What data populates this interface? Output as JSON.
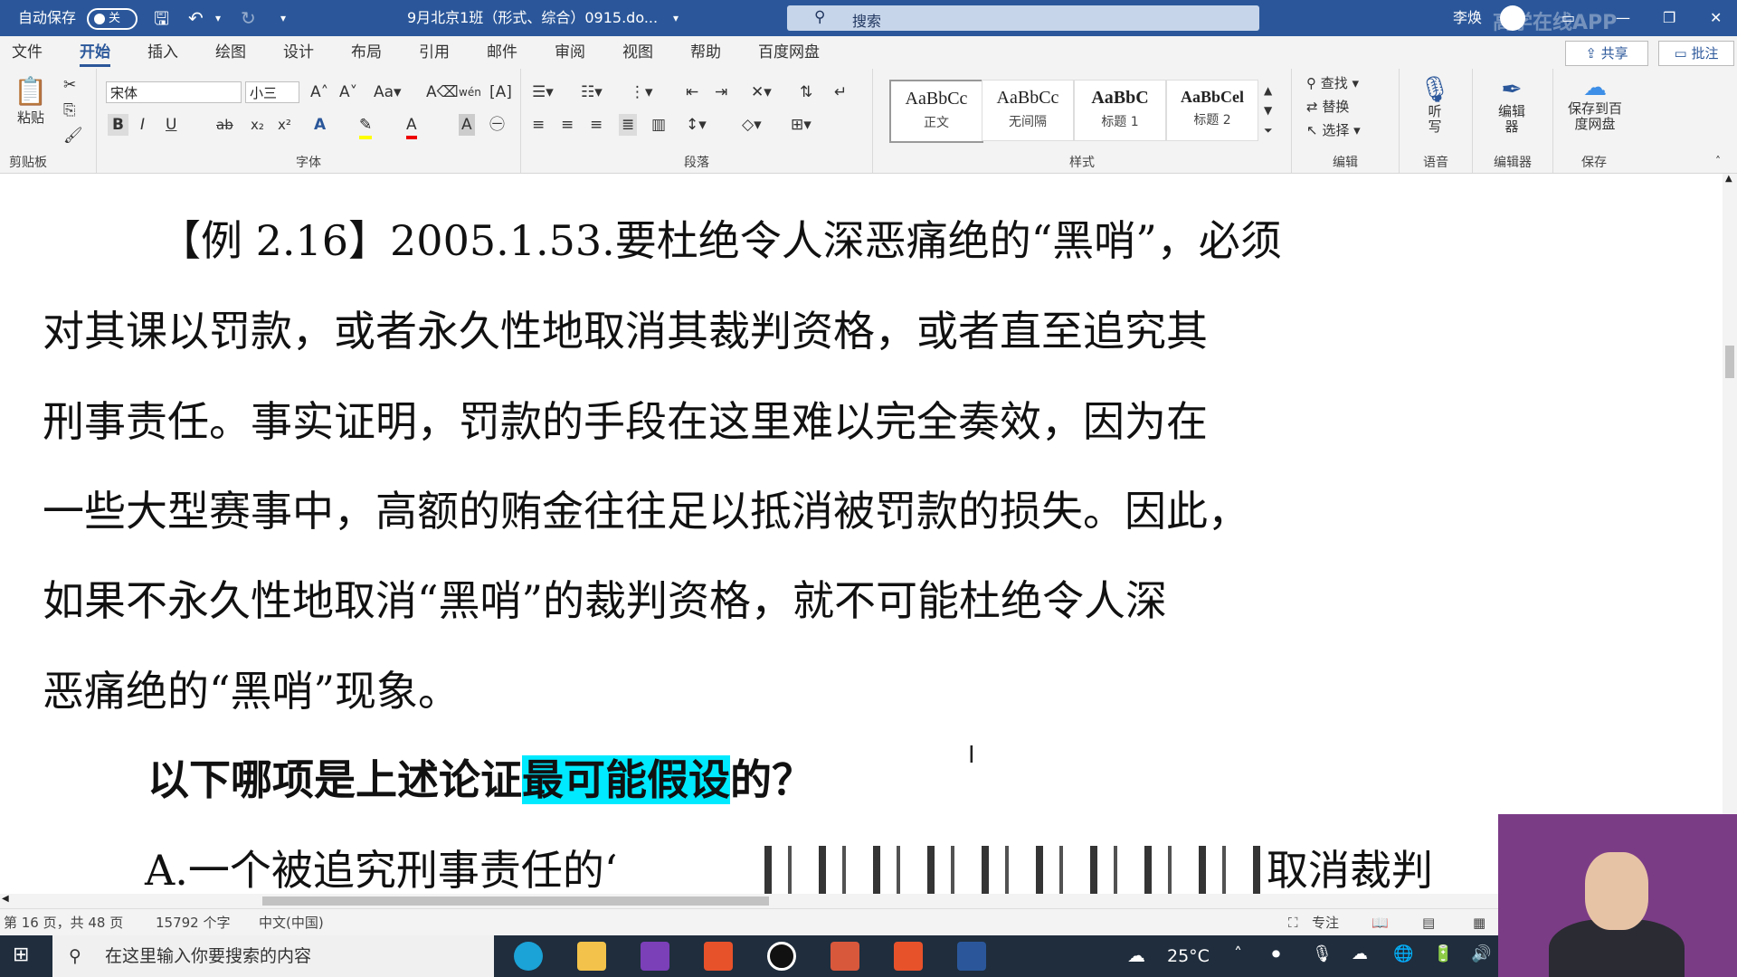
{
  "titlebar": {
    "autosave_label": "自动保存",
    "autosave_state": "关",
    "doc_title": "9月北京1班（形式、综合）0915.do...",
    "search_label": "搜索",
    "user_name": "李焕",
    "brand_watermark": "高学在线APP",
    "icons": [
      "save-icon",
      "undo-icon",
      "redo-icon",
      "customize-icon",
      "search-icon",
      "ribbon-display-icon",
      "minimize-icon",
      "restore-icon",
      "close-icon"
    ]
  },
  "menu": {
    "tabs": [
      "文件",
      "开始",
      "插入",
      "绘图",
      "设计",
      "布局",
      "引用",
      "邮件",
      "审阅",
      "视图",
      "帮助",
      "百度网盘"
    ],
    "active_tab": "开始",
    "share_label": "共享",
    "comment_label": "批注"
  },
  "ribbon": {
    "clipboard": {
      "paste_label": "粘贴",
      "group_label": "剪贴板"
    },
    "font": {
      "font_name": "宋体",
      "font_size": "小三",
      "group_label": "字体",
      "buttons": [
        "B",
        "I",
        "U",
        "ab",
        "x₂",
        "x²",
        "A",
        "A",
        "A"
      ]
    },
    "paragraph": {
      "group_label": "段落"
    },
    "styles": {
      "items": [
        {
          "preview": "AaBbCc",
          "name": "正文"
        },
        {
          "preview": "AaBbCc",
          "name": "无间隔"
        },
        {
          "preview": "AaBbC",
          "name": "标题 1"
        },
        {
          "preview": "AaBbCel",
          "name": "标题 2"
        }
      ],
      "group_label": "样式"
    },
    "editing": {
      "find": "查找",
      "replace": "替换",
      "select": "选择",
      "group_label": "编辑"
    },
    "voice": {
      "dictate_label": "听写",
      "group_label": "语音"
    },
    "editor": {
      "label": "编辑器",
      "group_label": "编辑器"
    },
    "save": {
      "label": "保存到百度网盘",
      "group_label": "保存"
    }
  },
  "document": {
    "lines": [
      "【例 2.16】2005.1.53.要杜绝令人深恶痛绝的“黑哨”，必须",
      "对其课以罚款，或者永久性地取消其裁判资格，或者直至追究其",
      "刑事责任。事实证明，罚款的手段在这里难以完全奏效，因为在",
      "一些大型赛事中，高额的贿金往往足以抵消被罚款的损失。因此，",
      "如果不永久性地取消“黑哨”的裁判资格，就不可能杜绝令人深",
      "恶痛绝的“黑哨”现象。"
    ],
    "question_pre": "以下哪项是上述论证",
    "question_highlight": "最可能假设",
    "question_post": "的？",
    "option_a_start": "A.一个被追究刑事责任的‘",
    "option_a_end": "取消裁判"
  },
  "statusbar": {
    "page": "第 16 页，共 48 页",
    "words": "15792 个字",
    "language": "中文(中国)",
    "focus": "专注"
  },
  "taskbar": {
    "search_placeholder": "在这里输入你要搜索的内容",
    "weather": "25°C",
    "apps": [
      "edge-icon",
      "file-explorer-icon",
      "onenote-icon",
      "app-x-icon",
      "record-icon",
      "powerpoint-icon",
      "app-x2-icon",
      "word-icon"
    ]
  },
  "colors": {
    "accent": "#2b579a",
    "highlight": "#00eaff"
  }
}
